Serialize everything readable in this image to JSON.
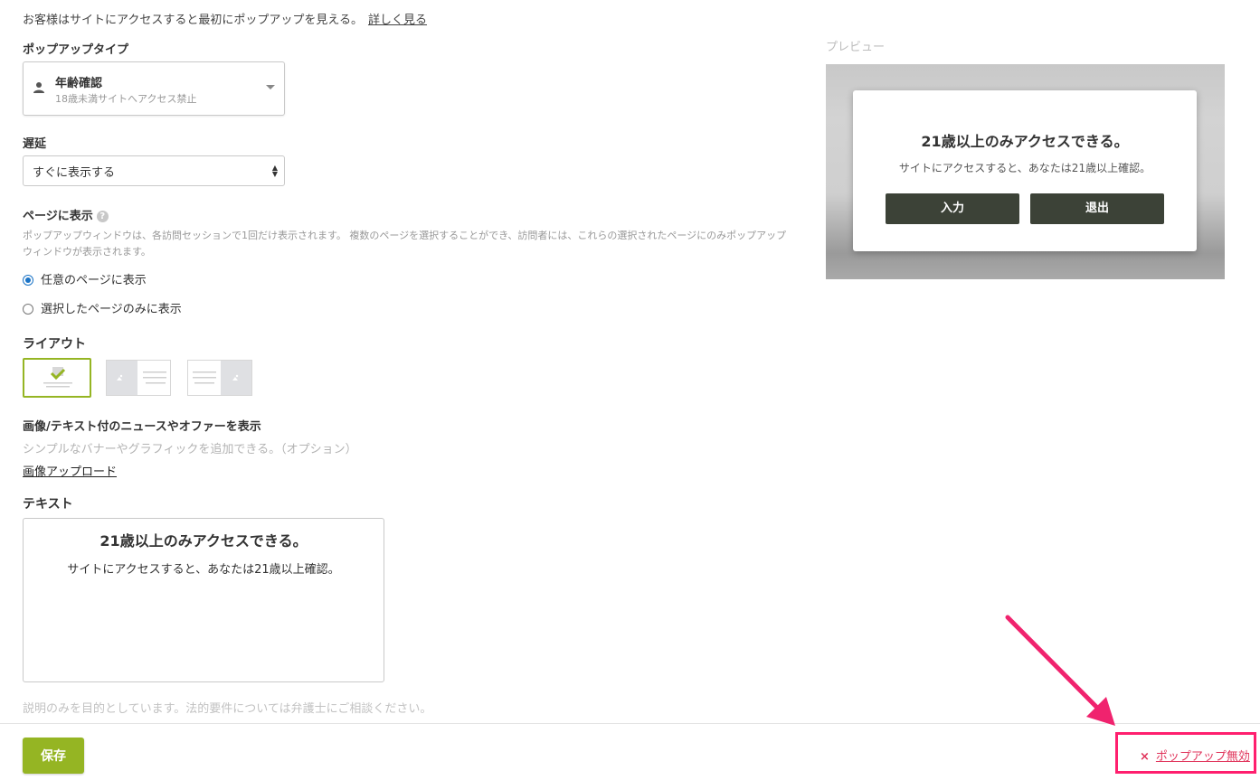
{
  "intro": {
    "text": "お客様はサイトにアクセスすると最初にポップアップを見える。",
    "link": "詳しく見る"
  },
  "popup_type": {
    "label": "ポップアップタイプ",
    "selected_title": "年齢確認",
    "selected_desc": "18歳未満サイトへアクセス禁止",
    "icon": "person-icon"
  },
  "delay": {
    "label": "遅延",
    "value": "すぐに表示する"
  },
  "page_display": {
    "label": "ページに表示",
    "help": "?",
    "desc": "ポップアップウィンドウは、各訪問セッションで1回だけ表示されます。 複数のページを選択することができ、訪問者には、これらの選択されたページにのみポップアップウィンドウが表示されます。",
    "options": [
      "任意のページに表示",
      "選択したページのみに表示"
    ],
    "selected_index": 0
  },
  "layout": {
    "label": "ライアウト",
    "options": [
      "text-only",
      "image-left",
      "image-right"
    ],
    "selected_index": 0
  },
  "news": {
    "label": "画像/テキスト付のニュースやオファーを表示",
    "desc": "シンプルなバナーやグラフィックを追加できる。（オプション）",
    "upload": "画像アップロード"
  },
  "text": {
    "label": "テキスト",
    "heading": "21歳以上のみアクセスできる。",
    "body": "サイトにアクセスすると、あなたは21歳以上確認。"
  },
  "disclaimer": "説明のみを目的としています。法的要件については弁護士にご相談ください。",
  "footer": {
    "save": "保存",
    "disable": "ポップアップ無効",
    "disable_icon": "×"
  },
  "preview": {
    "label": "プレビュー",
    "heading": "21歳以上のみアクセスできる。",
    "body": "サイトにアクセスすると、あなたは21歳以上確認。",
    "enter": "入力",
    "exit": "退出"
  },
  "colors": {
    "accent": "#95b523",
    "radio": "#1a73c6",
    "highlight": "#ff1f6e",
    "danger": "#e0335a",
    "preview_btn": "#3c4237"
  }
}
